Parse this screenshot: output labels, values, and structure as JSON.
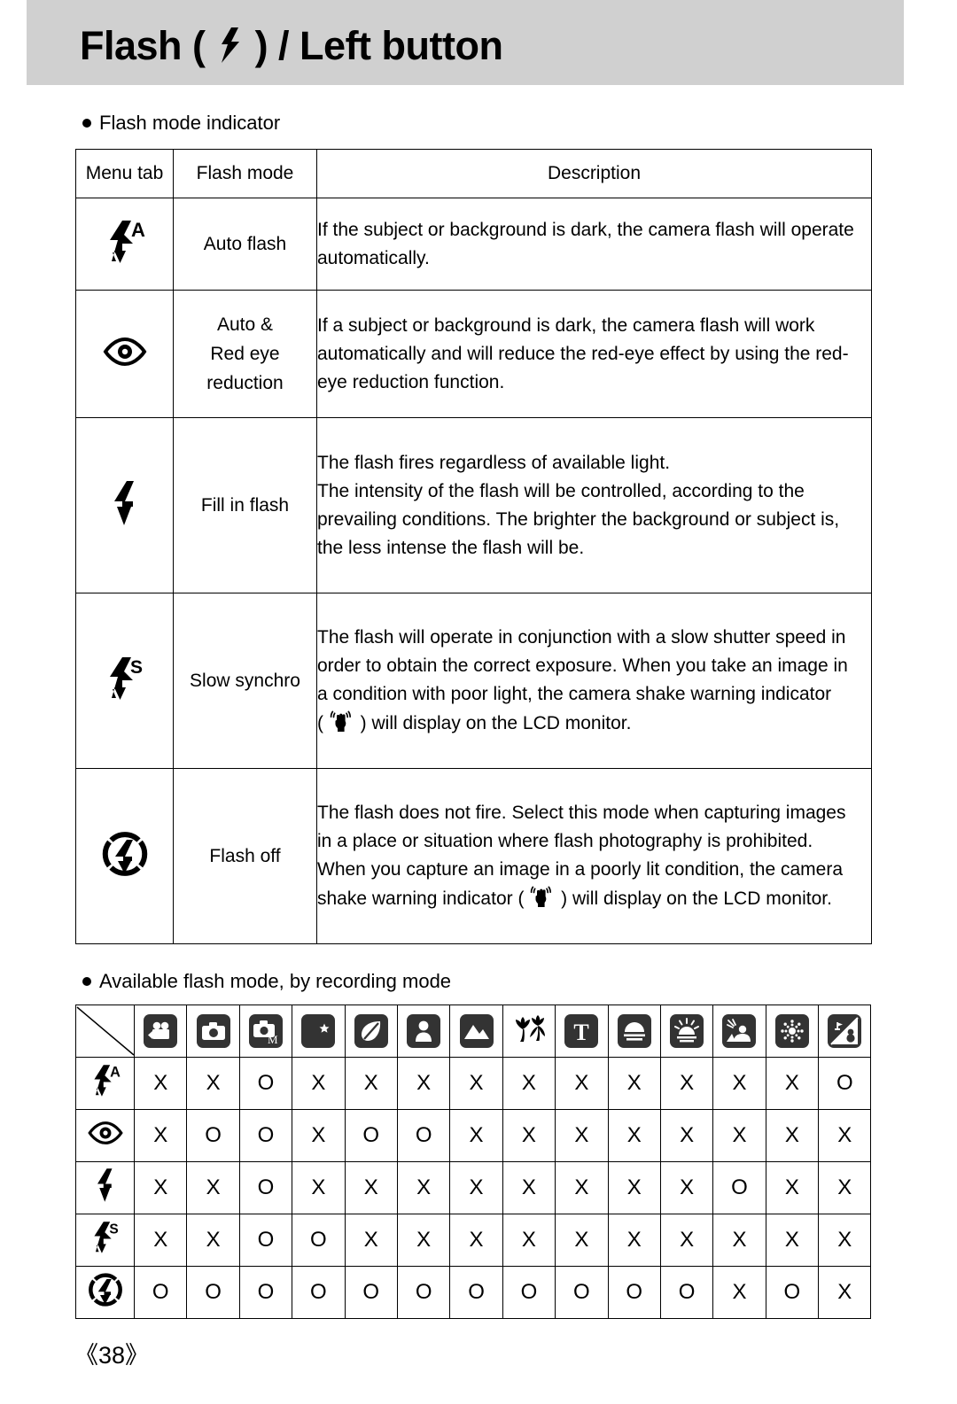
{
  "page": {
    "title_prefix": "Flash (",
    "title_suffix": ") / Left button",
    "title_icon": "flash-bolt-icon",
    "page_number": "《38》",
    "header_bg": "#d0d0d0"
  },
  "sections": {
    "indicator_heading": "Flash mode indicator",
    "available_heading": "Available flash mode, by recording mode"
  },
  "mode_table": {
    "headers": {
      "menu_tab": "Menu tab",
      "flash_mode": "Flash mode",
      "description": "Description"
    },
    "rows": [
      {
        "icon": "auto-flash-icon",
        "mode_lines": [
          "Auto flash"
        ],
        "description_lines": [
          "If the subject or background is dark, the camera flash will operate",
          "automatically."
        ]
      },
      {
        "icon": "red-eye-icon",
        "mode_lines": [
          "Auto &",
          "Red eye",
          "reduction"
        ],
        "description_lines": [
          "If a subject or background is dark, the camera flash will work",
          "automatically and will reduce the red-eye effect by using the red-",
          "eye reduction function."
        ]
      },
      {
        "icon": "fill-flash-icon",
        "mode_lines": [
          "Fill in flash"
        ],
        "description_lines": [
          "The flash fires regardless of available light.",
          "The intensity of the flash will be controlled, according to the",
          "prevailing conditions. The brighter the background or subject is,",
          "the less intense the flash will be."
        ]
      },
      {
        "icon": "slow-synchro-icon",
        "mode_lines": [
          "Slow synchro"
        ],
        "description_lines": [
          "The flash will operate in conjunction with a slow shutter speed in",
          "order to obtain the correct exposure. When you take an image in",
          "a condition with poor light, the camera shake warning indicator"
        ],
        "description_tail_prefix": "( ",
        "description_tail_icon": "camera-shake-icon",
        "description_tail_suffix": " ) will display on the LCD monitor."
      },
      {
        "icon": "flash-off-icon",
        "mode_lines": [
          "Flash off"
        ],
        "description_lines": [
          "The flash does not fire. Select this mode when capturing images",
          "in a place or situation where flash photography is prohibited.",
          "When you capture an image in a poorly lit condition, the camera"
        ],
        "description_tail_prefix": "shake warning indicator ( ",
        "description_tail_icon": "camera-shake-icon",
        "description_tail_suffix": " ) will display on the LCD monitor."
      }
    ]
  },
  "availability_matrix": {
    "recording_modes": [
      "movie-clip-icon",
      "auto-camera-icon",
      "manual-camera-icon",
      "night-scene-icon",
      "leaf-scene-icon",
      "portrait-icon",
      "landscape-icon",
      "close-up-icon",
      "text-icon",
      "sunset-icon",
      "dawn-icon",
      "backlight-icon",
      "fireworks-icon",
      "beach-snow-icon"
    ],
    "flash_rows": [
      {
        "icon": "auto-flash-icon",
        "values": [
          "X",
          "X",
          "O",
          "X",
          "X",
          "X",
          "X",
          "X",
          "X",
          "X",
          "X",
          "X",
          "X",
          "O"
        ]
      },
      {
        "icon": "red-eye-icon",
        "values": [
          "X",
          "O",
          "O",
          "X",
          "O",
          "O",
          "X",
          "X",
          "X",
          "X",
          "X",
          "X",
          "X",
          "X"
        ]
      },
      {
        "icon": "fill-flash-icon",
        "values": [
          "X",
          "X",
          "O",
          "X",
          "X",
          "X",
          "X",
          "X",
          "X",
          "X",
          "X",
          "O",
          "X",
          "X"
        ]
      },
      {
        "icon": "slow-synchro-icon",
        "values": [
          "X",
          "X",
          "O",
          "O",
          "X",
          "X",
          "X",
          "X",
          "X",
          "X",
          "X",
          "X",
          "X",
          "X"
        ]
      },
      {
        "icon": "flash-off-icon",
        "values": [
          "O",
          "O",
          "O",
          "O",
          "O",
          "O",
          "O",
          "O",
          "O",
          "O",
          "O",
          "X",
          "O",
          "X"
        ]
      }
    ]
  }
}
